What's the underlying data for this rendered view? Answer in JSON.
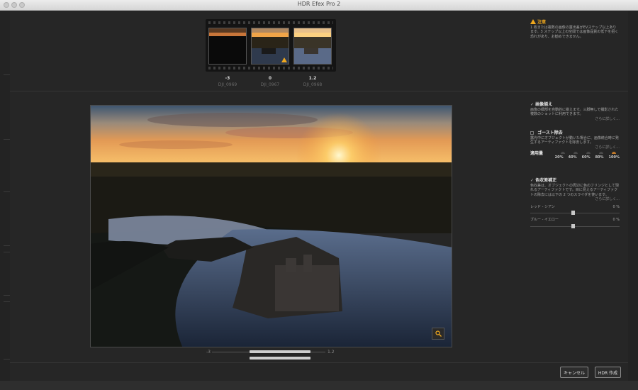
{
  "window": {
    "title": "HDR Efex Pro 2"
  },
  "filmstrip": {
    "frames": [
      {
        "ev": "-3",
        "filename": "DJI_0969",
        "warning": false
      },
      {
        "ev": "0",
        "filename": "DJI_0967",
        "warning": true
      },
      {
        "ev": "1.2",
        "filename": "DJI_0968",
        "warning": false
      }
    ]
  },
  "notice": {
    "title": "注意",
    "text": "1 枚または複数の画像の露出差がEVステップ以上あります。3 ステップ以上の空間では画像品質の低下を招く恐れがあり、お勧めできません。"
  },
  "alignment": {
    "label": "画像揃え",
    "checked": true,
    "desc": "画像の細部を自動的に揃えます。三脚無しで撮影された複数のショットに利用できます。",
    "more": "さらに詳しく..."
  },
  "ghost": {
    "label": "ゴースト除去",
    "checked": false,
    "desc": "露光中にオブジェクトが動いた場合に、画像統合時に発生するアーティファクトを除去します。",
    "more": "さらに詳しく...",
    "amount_label": "適用量",
    "levels": [
      "20%",
      "40%",
      "60%",
      "80%",
      "100%"
    ]
  },
  "chroma": {
    "label": "色収差補正",
    "checked": true,
    "desc": "色収差は、オブジェクトの周辺に色のフリンジとして現れるアーティファクトです。目に見えるアーティファクトの除去には以下の 2 つのスライダを使います。",
    "more": "さらに詳しく...",
    "red_cyan": {
      "label": "レッド - シアン",
      "value": "0 %"
    },
    "blue_yellow": {
      "label": "ブルー - イエロー",
      "value": "0 %"
    }
  },
  "align_bar": {
    "left_label": "-3",
    "right_label": "1.2"
  },
  "buttons": {
    "cancel": "キャンセル",
    "create": "HDR 作成"
  }
}
